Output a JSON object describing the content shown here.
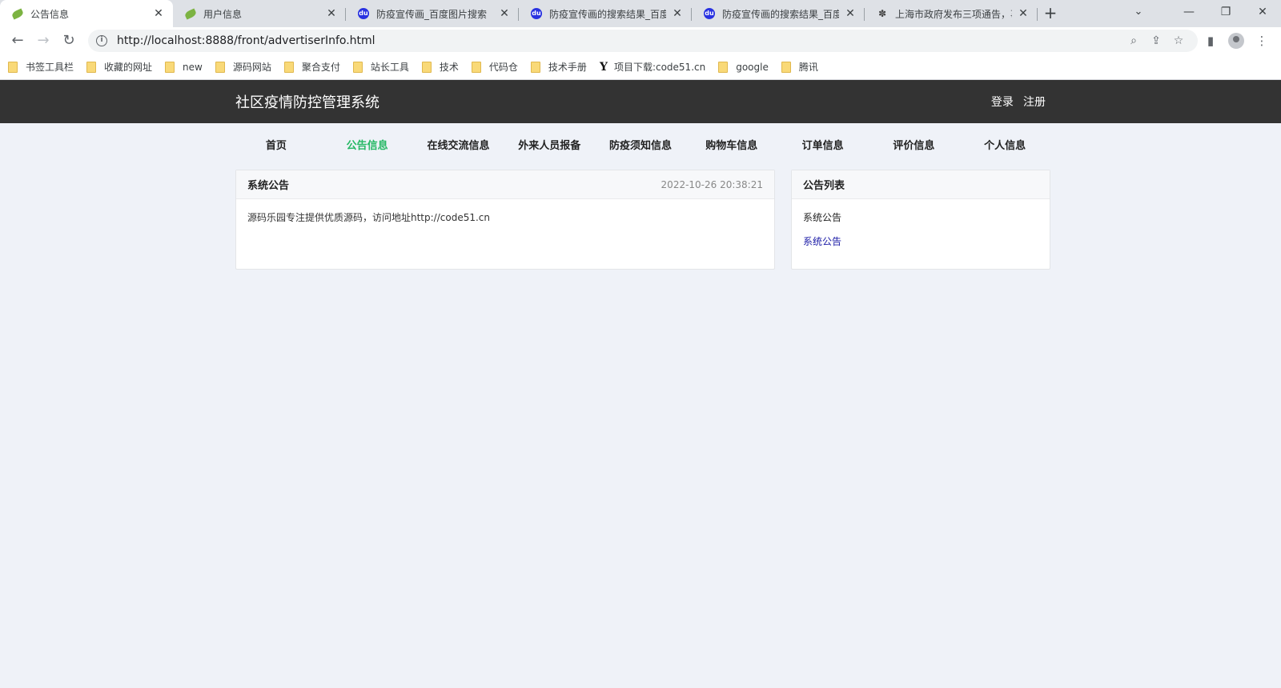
{
  "browser": {
    "tabs": [
      {
        "title": "公告信息",
        "icon": "leaf-icon",
        "active": true
      },
      {
        "title": "用户信息",
        "icon": "leaf-icon",
        "active": false
      },
      {
        "title": "防疫宣传画_百度图片搜索",
        "icon": "baidu-paw-icon",
        "active": false
      },
      {
        "title": "防疫宣传画的搜索结果_百度图",
        "icon": "baidu-paw-icon",
        "active": false
      },
      {
        "title": "防疫宣传画的搜索结果_百度图",
        "icon": "baidu-paw-icon",
        "active": false
      },
      {
        "title": "上海市政府发布三项通告，事",
        "icon": "gov-emblem-icon",
        "active": false
      }
    ],
    "new_tab_glyph": "+",
    "url_host": "http://localhost",
    "url_rest": ":8888/front/advertiserInfo.html",
    "bookmarks": [
      {
        "label": "书签工具栏",
        "icon": "folder-icon"
      },
      {
        "label": "收藏的网址",
        "icon": "folder-icon"
      },
      {
        "label": "new",
        "icon": "folder-icon"
      },
      {
        "label": "源码网站",
        "icon": "folder-icon"
      },
      {
        "label": "聚合支付",
        "icon": "folder-icon"
      },
      {
        "label": "站长工具",
        "icon": "folder-icon"
      },
      {
        "label": "技术",
        "icon": "folder-icon"
      },
      {
        "label": "代码仓",
        "icon": "folder-icon"
      },
      {
        "label": "技术手册",
        "icon": "folder-icon"
      },
      {
        "label": "项目下载:code51.cn",
        "icon": "y-logo-icon"
      },
      {
        "label": "google",
        "icon": "folder-icon"
      },
      {
        "label": "腾讯",
        "icon": "folder-icon"
      }
    ]
  },
  "site": {
    "title": "社区疫情防控管理系统",
    "login": "登录",
    "register": "注册",
    "nav": [
      {
        "label": "首页",
        "current": false
      },
      {
        "label": "公告信息",
        "current": true
      },
      {
        "label": "在线交流信息",
        "current": false
      },
      {
        "label": "外来人员报备",
        "current": false
      },
      {
        "label": "防疫须知信息",
        "current": false
      },
      {
        "label": "购物车信息",
        "current": false
      },
      {
        "label": "订单信息",
        "current": false
      },
      {
        "label": "评价信息",
        "current": false
      },
      {
        "label": "个人信息",
        "current": false
      }
    ],
    "accent_color": "#25b864"
  },
  "notice": {
    "title": "系统公告",
    "date": "2022-10-26 20:38:21",
    "body": "源码乐园专注提供优质源码，访问地址http://code51.cn"
  },
  "notice_list": {
    "title": "公告列表",
    "items": [
      {
        "label": "系统公告"
      },
      {
        "label": "系统公告"
      }
    ]
  }
}
